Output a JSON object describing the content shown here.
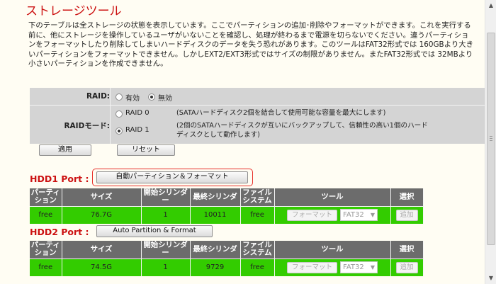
{
  "title": "ストレージツール",
  "description": "下のテーブルは全ストレージの状態を表示しています。ここでパーティションの追加･削除やフォーマットができます。これを実行する前に、他にストレージを操作しているユーザがいないことを確認し、処理が終わるまで電源を切らないでください。違うパーティションをフォーマットしたり削除してしまいハードディスクのデータを失う恐れがあります。このツールはFAT32形式では 160GBより大きいパーティションをフォーマットできません。しかしEXT2/EXT3形式ではサイズの制限がありません。またFAT32形式では 32MBより小さいパーティションを作成できません。",
  "raid": {
    "label": "RAID:",
    "options": [
      "有効",
      "無効"
    ],
    "selected": "無効",
    "mode_label": "RAIDモード:",
    "modes": [
      {
        "name": "RAID 0",
        "desc": "(SATAハードディスク2個を結合して使用可能な容量を最大にします)",
        "selected": false
      },
      {
        "name": "RAID 1",
        "desc": "(2個のSATAハードディスクが互いにバックアップして、信頼性の高い1個のハードディスクとして動作します)",
        "selected": true
      }
    ],
    "apply_label": "適用",
    "reset_label": "リセット"
  },
  "columns": [
    "パーティション",
    "サイズ",
    "開始シリンダー",
    "最終シリンダ",
    "ファイルシステム",
    "ツール",
    "選択"
  ],
  "hdd1": {
    "label": "HDD1 Port :",
    "button": "自動パーティション＆フォーマット",
    "row": {
      "partition": "free",
      "size": "76.7G",
      "start": "1",
      "end": "10011",
      "fs": "free",
      "format": "フォーマット",
      "fs_select": "FAT32",
      "add": "追加"
    }
  },
  "hdd2": {
    "label": "HDD2 Port :",
    "button": "Auto Partition & Format",
    "row": {
      "partition": "free",
      "size": "74.5G",
      "start": "1",
      "end": "9729",
      "fs": "free",
      "format": "フォーマット",
      "fs_select": "FAT32",
      "add": "追加"
    }
  },
  "colors": {
    "title": "#cc1111",
    "header": "#6c6c6c",
    "row": "#33cc00",
    "panel": "#d4d4d4",
    "highlight": "#e8302a"
  }
}
